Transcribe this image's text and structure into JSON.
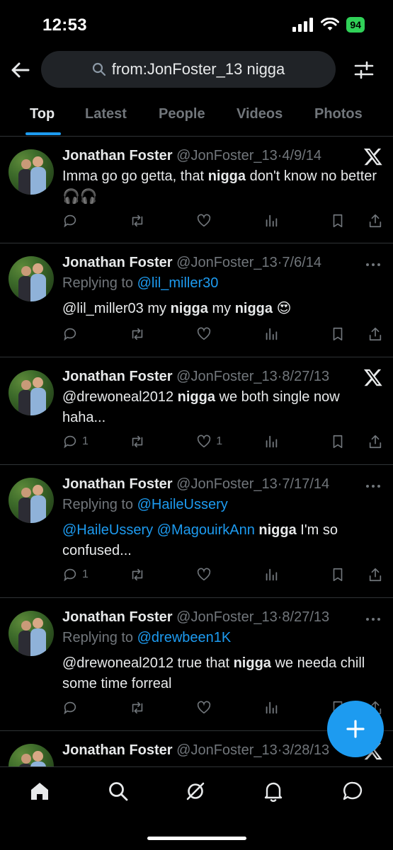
{
  "status": {
    "time": "12:53",
    "battery": "94"
  },
  "search": {
    "query": "from:JonFoster_13 nigga"
  },
  "tabs": [
    "Top",
    "Latest",
    "People",
    "Videos",
    "Photos"
  ],
  "active_tab": "Top",
  "colors": {
    "accent": "#1d9bf0",
    "background": "#000000",
    "muted": "#71767b",
    "text": "#e7e9ea"
  },
  "tweets": [
    {
      "name": "Jonathan Foster",
      "handle": "@JonFoster_13",
      "sep": "·",
      "date": "4/9/14",
      "corner_icon": "x-logo-icon",
      "reply_prefix": "",
      "reply_to": "",
      "text_1": "Imma go go getta, that ",
      "bold_1": "nigga",
      "text_2": " don't know no better 🎧🎧",
      "reply_count": "",
      "like_count": ""
    },
    {
      "name": "Jonathan Foster",
      "handle": "@JonFoster_13",
      "sep": "·",
      "date": "7/6/14",
      "corner_icon": "more-icon",
      "reply_prefix": "Replying to ",
      "reply_to": "@lil_miller30",
      "text_1": "@lil_miller03 my ",
      "bold_1": "nigga",
      "text_2": " my ",
      "bold_2": "nigga",
      "text_3": " 😍",
      "reply_count": "",
      "like_count": ""
    },
    {
      "name": "Jonathan Foster",
      "handle": "@JonFoster_13",
      "sep": "·",
      "date": "8/27/13",
      "corner_icon": "x-logo-icon",
      "reply_prefix": "",
      "reply_to": "",
      "text_1": "@drewoneal2012 ",
      "bold_1": "nigga",
      "text_2": " we both single now haha...",
      "reply_count": "1",
      "like_count": "1"
    },
    {
      "name": "Jonathan Foster",
      "handle": "@JonFoster_13",
      "sep": "·",
      "date": "7/17/14",
      "corner_icon": "more-icon",
      "reply_prefix": "Replying to ",
      "reply_to": "@HaileUssery",
      "mention_1": "@HaileUssery",
      "mention_2": "@MagouirkAnn",
      "bold_1": "nigga",
      "text_2": " I'm so confused...",
      "reply_count": "1",
      "like_count": ""
    },
    {
      "name": "Jonathan Foster",
      "handle": "@JonFoster_13",
      "sep": "·",
      "date": "8/27/13",
      "corner_icon": "more-icon",
      "reply_prefix": "Replying to ",
      "reply_to": "@drewbeen1K",
      "text_1": "@drewoneal2012 true that ",
      "bold_1": "nigga",
      "text_2": " we needa chill some time forreal",
      "reply_count": "",
      "like_count": ""
    },
    {
      "name": "Jonathan Foster",
      "handle": "@JonFoster_13",
      "sep": "·",
      "date": "3/28/13",
      "corner_icon": "x-logo-icon"
    }
  ],
  "nav": [
    "home-icon",
    "search-icon",
    "grok-icon",
    "notifications-icon",
    "messages-icon"
  ],
  "fab_icon": "plus-icon"
}
